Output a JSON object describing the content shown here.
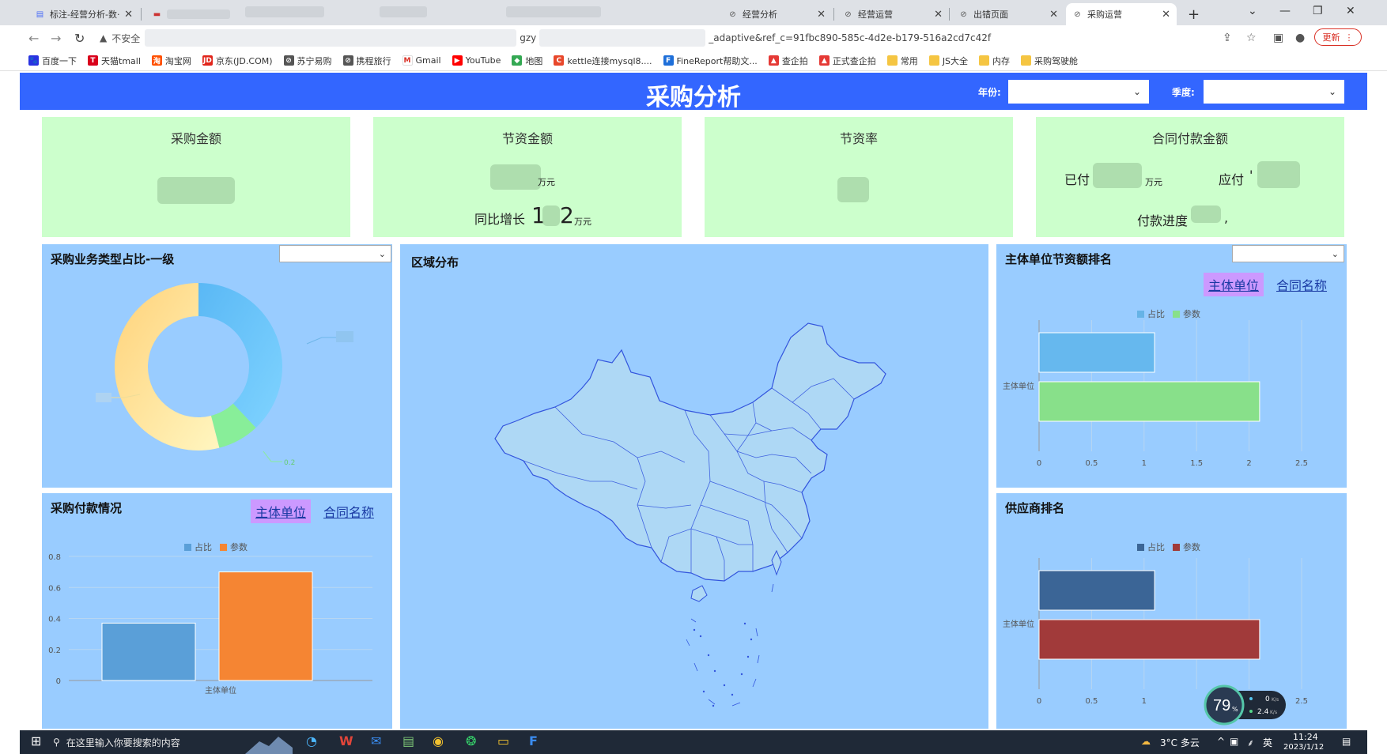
{
  "browser": {
    "tabs": [
      {
        "title": "标注-经营分析-数·",
        "icon": "doc-icon"
      },
      {
        "title": "",
        "icon": "sheet-icon"
      },
      {
        "title": "经营分析",
        "icon": "globe-icon"
      },
      {
        "title": "经营运营",
        "icon": "globe-icon"
      },
      {
        "title": "出错页面",
        "icon": "globe-icon"
      },
      {
        "title": "采购运营",
        "icon": "globe-icon"
      }
    ],
    "new_tab": "+",
    "window_controls": {
      "dropdown": "⌄",
      "minimize": "—",
      "restore": "❐",
      "close": "✕"
    },
    "address": {
      "insecure_label": "不安全",
      "url_fragment_1": "gzy",
      "url_fragment_2": "_adaptive&ref_c=91fbc890-585c-4d2e-b179-516a2cd7c42f"
    },
    "update_label": "更新",
    "bookmarks": [
      {
        "label": "百度一下",
        "color": "#2932e1",
        "glyph": "🐾"
      },
      {
        "label": "天猫tmall",
        "color": "#d9001b",
        "glyph": "T"
      },
      {
        "label": "淘宝网",
        "color": "#ff5000",
        "glyph": "淘"
      },
      {
        "label": "京东(JD.COM)",
        "color": "#e1251b",
        "glyph": "JD"
      },
      {
        "label": "苏宁易购",
        "color": "#555555",
        "glyph": "⊘"
      },
      {
        "label": "携程旅行",
        "color": "#555555",
        "glyph": "⊘"
      },
      {
        "label": "Gmail",
        "color": "#ffffff",
        "glyph": "M"
      },
      {
        "label": "YouTube",
        "color": "#ff0000",
        "glyph": "▶"
      },
      {
        "label": "地图",
        "color": "#34a853",
        "glyph": "◆"
      },
      {
        "label": "kettle连接mysql8....",
        "color": "#e8472b",
        "glyph": "C"
      },
      {
        "label": "FineReport帮助文...",
        "color": "#1e6fd9",
        "glyph": "F"
      },
      {
        "label": "查企拍",
        "color": "#e53935",
        "glyph": "▲"
      },
      {
        "label": "正式查企拍",
        "color": "#e53935",
        "glyph": "▲"
      },
      {
        "label": "常用",
        "color": "#f5c542",
        "glyph": ""
      },
      {
        "label": "JS大全",
        "color": "#f5c542",
        "glyph": ""
      },
      {
        "label": "内存",
        "color": "#f5c542",
        "glyph": ""
      },
      {
        "label": "采购驾驶舱",
        "color": "#f5c542",
        "glyph": ""
      }
    ]
  },
  "header": {
    "title": "采购分析",
    "year_label": "年份:",
    "season_label": "季度:"
  },
  "kpis": {
    "purchase_amount": {
      "title": "采购金额"
    },
    "savings_amount": {
      "title": "节资金额",
      "unit": "万元",
      "yoy_label": "同比增长",
      "yoy_prefix": "1",
      "yoy_suffix": "2",
      "yoy_unit": "万元"
    },
    "savings_rate": {
      "title": "节资率"
    },
    "contract_payment": {
      "title": "合同付款金额",
      "paid_label": "已付",
      "paid_unit": "万元",
      "due_label": "应付",
      "due_prefix": "'",
      "progress_label": "付款进度",
      "progress_suffix": ","
    }
  },
  "panels": {
    "business_type": {
      "title": "采购业务类型占比-一级",
      "donut_label": "0.2",
      "slices": [
        {
          "value": 0.38,
          "color": "#66bbff"
        },
        {
          "value": 0.08,
          "color": "#88ee99"
        },
        {
          "value": 0.54,
          "color": "#ffeeaa"
        }
      ]
    },
    "region": {
      "title": "区域分布"
    },
    "unit_savings": {
      "title": "主体单位节资额排名",
      "toggle_active": "主体单位",
      "toggle_other": "合同名称",
      "legend": [
        {
          "name": "占比",
          "color": "#66b3e6"
        },
        {
          "name": "参数",
          "color": "#88e08a"
        }
      ]
    },
    "payment": {
      "title": "采购付款情况",
      "toggle_active": "主体单位",
      "toggle_other": "合同名称",
      "legend": [
        {
          "name": "占比",
          "color": "#5a9fd8"
        },
        {
          "name": "参数",
          "color": "#f58533"
        }
      ]
    },
    "supplier": {
      "title": "供应商排名",
      "legend": [
        {
          "name": "占比",
          "color": "#3b6596"
        },
        {
          "name": "参数",
          "color": "#a13a3a"
        }
      ]
    }
  },
  "chart_data": [
    {
      "type": "bar",
      "orientation": "horizontal",
      "categories": [
        "主体单位"
      ],
      "series": [
        {
          "name": "占比",
          "values": [
            1.1
          ]
        },
        {
          "name": "参数",
          "values": [
            2.1
          ]
        }
      ],
      "xlim": [
        0,
        2.5
      ],
      "xticks": [
        "0",
        "0.5",
        "1",
        "1.5",
        "2",
        "2.5"
      ],
      "grid": true,
      "legend_position": "top"
    },
    {
      "type": "bar",
      "orientation": "vertical",
      "categories": [
        "主体单位"
      ],
      "series": [
        {
          "name": "占比",
          "values": [
            0.37
          ]
        },
        {
          "name": "参数",
          "values": [
            0.7
          ]
        }
      ],
      "ylim": [
        0,
        0.8
      ],
      "yticks": [
        "0",
        "0.2",
        "0.4",
        "0.6",
        "0.8"
      ],
      "grid": true,
      "legend_position": "top"
    },
    {
      "type": "bar",
      "orientation": "horizontal",
      "categories": [
        "主体单位"
      ],
      "series": [
        {
          "name": "占比",
          "values": [
            1.1
          ]
        },
        {
          "name": "参数",
          "values": [
            2.1
          ]
        }
      ],
      "xlim": [
        0,
        2.5
      ],
      "xticks": [
        "0",
        "0.5",
        "1",
        "",
        "",
        "2.5"
      ],
      "grid": true,
      "legend_position": "top"
    }
  ],
  "widget": {
    "percent": "79",
    "percent_unit": "%",
    "up": "0",
    "down": "2.4",
    "rate_unit": "K/s"
  },
  "taskbar": {
    "search_placeholder": "在这里输入你要搜索的内容",
    "weather": "3°C 多云",
    "ime": "英",
    "time": "11:24",
    "date": "2023/1/12"
  }
}
